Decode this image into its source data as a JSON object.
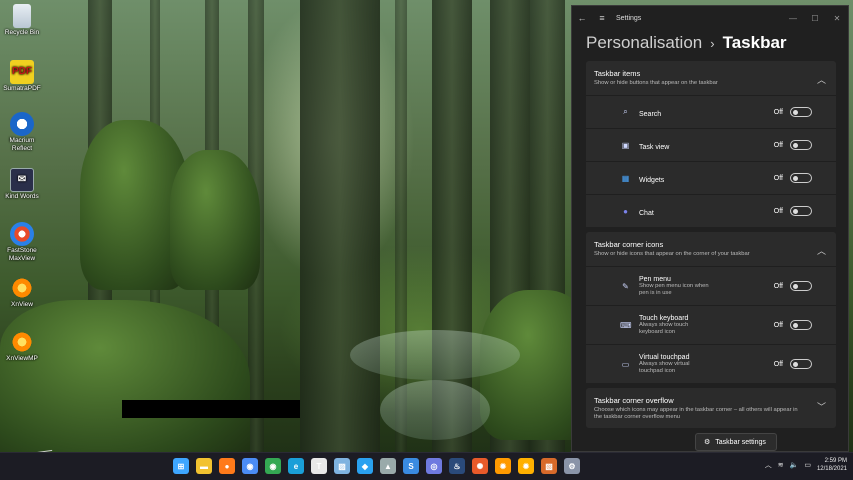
{
  "desktop": {
    "icons": [
      {
        "label": "Recycle Bin",
        "icon": "recycle-bin-icon"
      },
      {
        "label": "SumatraPDF",
        "icon": "pdf-icon",
        "glyph": "PDF"
      },
      {
        "label": "Macrium Reflect",
        "icon": "macrium-icon"
      },
      {
        "label": "Kind Words",
        "icon": "envelope-icon",
        "glyph": "✉"
      },
      {
        "label": "FastStone MaxView",
        "icon": "faststone-icon"
      },
      {
        "label": "XnView",
        "icon": "xnview-icon"
      },
      {
        "label": "XnViewMP",
        "icon": "xnviewmp-icon"
      }
    ]
  },
  "settings": {
    "titlebar": {
      "back": "←",
      "menu": "≡",
      "title": "Settings",
      "minimize": "—",
      "maximize": "☐",
      "close": "✕"
    },
    "breadcrumb": {
      "parent": "Personalisation",
      "separator": "›",
      "current": "Taskbar"
    },
    "sections": [
      {
        "title": "Taskbar items",
        "description": "Show or hide buttons that appear on the taskbar",
        "chevron": "︿",
        "rows": [
          {
            "label": "Search",
            "icon": "search-icon",
            "glyph": "⌕",
            "state": "Off"
          },
          {
            "label": "Task view",
            "icon": "task-view-icon",
            "glyph": "▣",
            "state": "Off"
          },
          {
            "label": "Widgets",
            "icon": "widgets-icon",
            "glyph": "▦",
            "state": "Off"
          },
          {
            "label": "Chat",
            "icon": "chat-icon",
            "glyph": "●",
            "state": "Off"
          }
        ]
      },
      {
        "title": "Taskbar corner icons",
        "description": "Show or hide icons that appear on the corner of your taskbar",
        "chevron": "︿",
        "rows": [
          {
            "label": "Pen menu",
            "sub": "Show pen menu icon when pen is in use",
            "icon": "pen-icon",
            "glyph": "✎",
            "state": "Off"
          },
          {
            "label": "Touch keyboard",
            "sub": "Always show touch keyboard icon",
            "icon": "keyboard-icon",
            "glyph": "⌨",
            "state": "Off"
          },
          {
            "label": "Virtual touchpad",
            "sub": "Always show virtual touchpad icon",
            "icon": "touchpad-icon",
            "glyph": "▭",
            "state": "Off"
          }
        ]
      },
      {
        "title": "Taskbar corner overflow",
        "description": "Choose which icons may appear in the taskbar corner – all others will appear in the taskbar corner overflow menu",
        "chevron": "﹀"
      }
    ],
    "tooltip": "Taskbar settings"
  },
  "taskbar": {
    "apps": [
      {
        "name": "start-icon",
        "glyph": "⊞",
        "color": "#3ea6ff"
      },
      {
        "name": "file-explorer-icon",
        "glyph": "▬",
        "color": "#f2c230"
      },
      {
        "name": "firefox-icon",
        "glyph": "●",
        "color": "#ff7a1a"
      },
      {
        "name": "chrome-beta-icon",
        "glyph": "◉",
        "color": "#4b8cf5"
      },
      {
        "name": "chrome-icon",
        "glyph": "◉",
        "color": "#34a853"
      },
      {
        "name": "edge-icon",
        "glyph": "e",
        "color": "#1a9fd8"
      },
      {
        "name": "typora-icon",
        "glyph": "T",
        "color": "#e8e8e8"
      },
      {
        "name": "photos-icon",
        "glyph": "▨",
        "color": "#7fb3e0"
      },
      {
        "name": "vscode-icon",
        "glyph": "◆",
        "color": "#2aa1f0"
      },
      {
        "name": "vlc-icon",
        "glyph": "▲",
        "color": "#9aa"
      },
      {
        "name": "notepad-icon",
        "glyph": "S",
        "color": "#3a8be0"
      },
      {
        "name": "app-icon",
        "glyph": "◎",
        "color": "#6f7ae0"
      },
      {
        "name": "steam-icon",
        "glyph": "♨",
        "color": "#2a4a7a"
      },
      {
        "name": "faststone-task-icon",
        "glyph": "✺",
        "color": "#e85a2a"
      },
      {
        "name": "xnview-task-icon",
        "glyph": "✹",
        "color": "#ff9a00"
      },
      {
        "name": "xnviewmp-task-icon",
        "glyph": "✹",
        "color": "#ffb000"
      },
      {
        "name": "image-app-icon",
        "glyph": "▧",
        "color": "#d86a2a"
      },
      {
        "name": "settings-icon",
        "glyph": "⚙",
        "color": "#8a94a8"
      }
    ],
    "tray": {
      "overflow": "︿",
      "network": "≋",
      "volume": "🔈",
      "battery": "▭",
      "time": "2:59 PM",
      "date": "12/18/2021"
    }
  }
}
